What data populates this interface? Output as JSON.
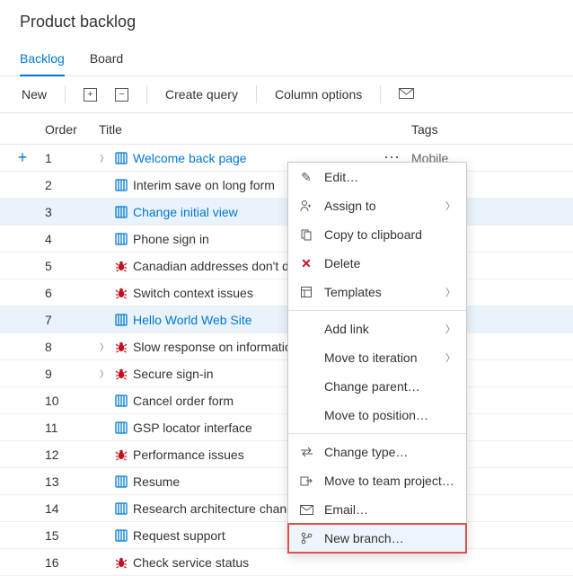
{
  "header": {
    "title": "Product backlog"
  },
  "tabs": [
    {
      "label": "Backlog",
      "active": true
    },
    {
      "label": "Board",
      "active": false
    }
  ],
  "toolbar": {
    "new_label": "New",
    "create_query_label": "Create query",
    "column_options_label": "Column options"
  },
  "columns": {
    "order": "Order",
    "title": "Title",
    "tags": "Tags"
  },
  "rows": [
    {
      "order": "1",
      "expand": true,
      "type": "pbi",
      "title": "Welcome back page",
      "tag": "Mobile",
      "showAdd": true,
      "showMenu": true,
      "first": true
    },
    {
      "order": "2",
      "type": "pbi",
      "title": "Interim save on long form"
    },
    {
      "order": "3",
      "type": "pbi",
      "title": "Change initial view",
      "selected": true
    },
    {
      "order": "4",
      "type": "pbi",
      "title": "Phone sign in"
    },
    {
      "order": "5",
      "type": "bug",
      "title": "Canadian addresses don't disp"
    },
    {
      "order": "6",
      "type": "bug",
      "title": "Switch context issues"
    },
    {
      "order": "7",
      "type": "pbi",
      "title": "Hello World Web Site",
      "selected": true
    },
    {
      "order": "8",
      "expand": true,
      "type": "bug",
      "title": "Slow response on information"
    },
    {
      "order": "9",
      "expand": true,
      "type": "bug",
      "title": "Secure sign-in"
    },
    {
      "order": "10",
      "type": "pbi",
      "title": "Cancel order form"
    },
    {
      "order": "11",
      "type": "pbi",
      "title": "GSP locator interface"
    },
    {
      "order": "12",
      "type": "bug",
      "title": "Performance issues"
    },
    {
      "order": "13",
      "type": "pbi",
      "title": "Resume"
    },
    {
      "order": "14",
      "type": "pbi",
      "title": "Research architecture changes"
    },
    {
      "order": "15",
      "type": "pbi",
      "title": "Request support"
    },
    {
      "order": "16",
      "type": "bug",
      "title": "Check service status"
    }
  ],
  "menu": {
    "edit": "Edit…",
    "assign_to": "Assign to",
    "copy": "Copy to clipboard",
    "delete": "Delete",
    "templates": "Templates",
    "add_link": "Add link",
    "move_iter": "Move to iteration",
    "change_parent": "Change parent…",
    "move_pos": "Move to position…",
    "change_type": "Change type…",
    "move_team": "Move to team project…",
    "email": "Email…",
    "new_branch": "New branch…"
  }
}
